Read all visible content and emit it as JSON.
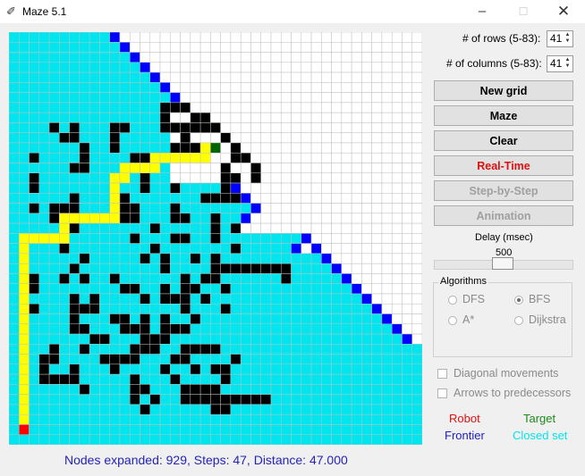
{
  "window": {
    "title": "Maze 5.1",
    "icon": "feather-icon"
  },
  "controls": {
    "rows_label": "# of rows (5-83):",
    "rows_value": "41",
    "cols_label": "# of columns (5-83):",
    "cols_value": "41"
  },
  "buttons": {
    "new_grid": "New grid",
    "maze": "Maze",
    "clear": "Clear",
    "real_time": "Real-Time",
    "step_by_step": "Step-by-Step",
    "animation": "Animation"
  },
  "delay": {
    "label": "Delay (msec)",
    "value": "500"
  },
  "algorithms": {
    "title": "Algorithms",
    "options": [
      "DFS",
      "BFS",
      "A*",
      "Dijkstra"
    ],
    "selected": "BFS"
  },
  "options": {
    "diagonal": "Diagonal movements",
    "arrows": "Arrows to predecessors",
    "diagonal_checked": false,
    "arrows_checked": false
  },
  "legend": {
    "robot": "Robot",
    "target": "Target",
    "frontier": "Frontier",
    "closed": "Closed set",
    "robot_color": "#e01010",
    "target_color": "#1a8a1a",
    "frontier_color": "#2020c0",
    "closed_color": "#00e5ee"
  },
  "status": "Nodes expanded: 929, Steps: 47, Distance: 47.000",
  "grid": {
    "rows": 41,
    "cols": 41,
    "colors": {
      "closed": "#00e5ee",
      "frontier": "#0000ff",
      "wall": "#000000",
      "path": "#ffff00",
      "robot": "#ff0000",
      "target": "#006400",
      "empty": "#ffffff",
      "gridline": "#bfbfbf"
    },
    "robot": [
      39,
      1
    ],
    "target": [
      11,
      20
    ],
    "frontier": [
      [
        0,
        10
      ],
      [
        1,
        11
      ],
      [
        2,
        12
      ],
      [
        3,
        13
      ],
      [
        4,
        14
      ],
      [
        5,
        15
      ],
      [
        6,
        16
      ],
      [
        15,
        22
      ],
      [
        16,
        23
      ],
      [
        17,
        24
      ],
      [
        18,
        23
      ],
      [
        19,
        22
      ],
      [
        20,
        29
      ],
      [
        21,
        28
      ],
      [
        21,
        30
      ],
      [
        22,
        31
      ],
      [
        23,
        32
      ],
      [
        24,
        33
      ],
      [
        25,
        34
      ],
      [
        26,
        35
      ],
      [
        27,
        36
      ],
      [
        28,
        37
      ],
      [
        29,
        38
      ],
      [
        30,
        39
      ]
    ],
    "walls": [
      [
        7,
        15
      ],
      [
        7,
        16
      ],
      [
        7,
        17
      ],
      [
        8,
        15
      ],
      [
        8,
        18
      ],
      [
        8,
        19
      ],
      [
        9,
        4
      ],
      [
        9,
        6
      ],
      [
        9,
        10
      ],
      [
        9,
        11
      ],
      [
        9,
        15
      ],
      [
        9,
        16
      ],
      [
        9,
        17
      ],
      [
        9,
        18
      ],
      [
        9,
        19
      ],
      [
        9,
        20
      ],
      [
        10,
        5
      ],
      [
        10,
        6
      ],
      [
        10,
        10
      ],
      [
        10,
        17
      ],
      [
        10,
        21
      ],
      [
        11,
        7
      ],
      [
        11,
        10
      ],
      [
        11,
        16
      ],
      [
        11,
        17
      ],
      [
        11,
        18
      ],
      [
        11,
        19
      ],
      [
        11,
        22
      ],
      [
        12,
        2
      ],
      [
        12,
        7
      ],
      [
        12,
        12
      ],
      [
        12,
        13
      ],
      [
        12,
        22
      ],
      [
        12,
        23
      ],
      [
        13,
        6
      ],
      [
        13,
        7
      ],
      [
        13,
        21
      ],
      [
        13,
        24
      ],
      [
        14,
        2
      ],
      [
        14,
        13
      ],
      [
        14,
        21
      ],
      [
        14,
        22
      ],
      [
        14,
        24
      ],
      [
        15,
        2
      ],
      [
        15,
        10
      ],
      [
        15,
        13
      ],
      [
        15,
        16
      ],
      [
        15,
        21
      ],
      [
        16,
        6
      ],
      [
        16,
        11
      ],
      [
        16,
        19
      ],
      [
        16,
        20
      ],
      [
        16,
        21
      ],
      [
        16,
        22
      ],
      [
        17,
        2
      ],
      [
        17,
        4
      ],
      [
        17,
        5
      ],
      [
        17,
        6
      ],
      [
        17,
        11
      ],
      [
        17,
        12
      ],
      [
        17,
        16
      ],
      [
        18,
        4
      ],
      [
        18,
        11
      ],
      [
        18,
        12
      ],
      [
        18,
        16
      ],
      [
        18,
        17
      ],
      [
        18,
        20
      ],
      [
        19,
        6
      ],
      [
        19,
        14
      ],
      [
        19,
        20
      ],
      [
        19,
        22
      ],
      [
        20,
        12
      ],
      [
        20,
        16
      ],
      [
        20,
        17
      ],
      [
        20,
        20
      ],
      [
        21,
        5
      ],
      [
        21,
        14
      ],
      [
        21,
        22
      ],
      [
        22,
        7
      ],
      [
        22,
        13
      ],
      [
        22,
        15
      ],
      [
        22,
        18
      ],
      [
        22,
        20
      ],
      [
        23,
        6
      ],
      [
        23,
        15
      ],
      [
        23,
        20
      ],
      [
        23,
        21
      ],
      [
        23,
        22
      ],
      [
        23,
        23
      ],
      [
        23,
        24
      ],
      [
        23,
        25
      ],
      [
        23,
        26
      ],
      [
        23,
        27
      ],
      [
        24,
        2
      ],
      [
        24,
        5
      ],
      [
        24,
        7
      ],
      [
        24,
        10
      ],
      [
        24,
        17
      ],
      [
        24,
        19
      ],
      [
        24,
        20
      ],
      [
        24,
        27
      ],
      [
        25,
        2
      ],
      [
        25,
        11
      ],
      [
        25,
        12
      ],
      [
        25,
        15
      ],
      [
        25,
        17
      ],
      [
        25,
        18
      ],
      [
        25,
        21
      ],
      [
        26,
        6
      ],
      [
        26,
        8
      ],
      [
        26,
        13
      ],
      [
        26,
        15
      ],
      [
        26,
        16
      ],
      [
        26,
        17
      ],
      [
        26,
        19
      ],
      [
        27,
        2
      ],
      [
        27,
        6
      ],
      [
        27,
        7
      ],
      [
        27,
        8
      ],
      [
        27,
        17
      ],
      [
        27,
        21
      ],
      [
        28,
        6
      ],
      [
        28,
        10
      ],
      [
        28,
        11
      ],
      [
        28,
        13
      ],
      [
        28,
        15
      ],
      [
        28,
        18
      ],
      [
        29,
        6
      ],
      [
        29,
        7
      ],
      [
        29,
        11
      ],
      [
        29,
        12
      ],
      [
        29,
        13
      ],
      [
        29,
        15
      ],
      [
        29,
        16
      ],
      [
        29,
        17
      ],
      [
        30,
        8
      ],
      [
        30,
        9
      ],
      [
        30,
        13
      ],
      [
        30,
        14
      ],
      [
        30,
        15
      ],
      [
        31,
        4
      ],
      [
        31,
        7
      ],
      [
        31,
        12
      ],
      [
        31,
        13
      ],
      [
        31,
        14
      ],
      [
        31,
        17
      ],
      [
        31,
        18
      ],
      [
        31,
        19
      ],
      [
        31,
        20
      ],
      [
        32,
        3
      ],
      [
        32,
        4
      ],
      [
        32,
        9
      ],
      [
        32,
        10
      ],
      [
        32,
        11
      ],
      [
        32,
        12
      ],
      [
        32,
        16
      ],
      [
        32,
        17
      ],
      [
        32,
        22
      ],
      [
        33,
        3
      ],
      [
        33,
        6
      ],
      [
        33,
        10
      ],
      [
        33,
        15
      ],
      [
        33,
        18
      ],
      [
        33,
        20
      ],
      [
        33,
        21
      ],
      [
        34,
        3
      ],
      [
        34,
        4
      ],
      [
        34,
        5
      ],
      [
        34,
        6
      ],
      [
        34,
        12
      ],
      [
        34,
        16
      ],
      [
        34,
        21
      ],
      [
        35,
        7
      ],
      [
        35,
        12
      ],
      [
        35,
        13
      ],
      [
        35,
        17
      ],
      [
        35,
        18
      ],
      [
        35,
        19
      ],
      [
        35,
        20
      ],
      [
        36,
        12
      ],
      [
        36,
        14
      ],
      [
        36,
        17
      ],
      [
        36,
        18
      ],
      [
        36,
        19
      ],
      [
        36,
        20
      ],
      [
        36,
        21
      ],
      [
        36,
        22
      ],
      [
        36,
        23
      ],
      [
        36,
        24
      ],
      [
        36,
        25
      ],
      [
        37,
        13
      ],
      [
        37,
        20
      ],
      [
        37,
        21
      ]
    ],
    "path": [
      [
        11,
        19
      ],
      [
        11,
        20
      ],
      [
        12,
        14
      ],
      [
        12,
        15
      ],
      [
        12,
        16
      ],
      [
        12,
        17
      ],
      [
        12,
        18
      ],
      [
        12,
        19
      ],
      [
        13,
        11
      ],
      [
        13,
        12
      ],
      [
        13,
        13
      ],
      [
        13,
        14
      ],
      [
        14,
        10
      ],
      [
        14,
        11
      ],
      [
        15,
        10
      ],
      [
        16,
        10
      ],
      [
        17,
        10
      ],
      [
        18,
        5
      ],
      [
        18,
        6
      ],
      [
        18,
        7
      ],
      [
        18,
        8
      ],
      [
        18,
        9
      ],
      [
        18,
        10
      ],
      [
        19,
        5
      ],
      [
        20,
        1
      ],
      [
        20,
        2
      ],
      [
        20,
        3
      ],
      [
        20,
        4
      ],
      [
        20,
        5
      ],
      [
        21,
        1
      ],
      [
        22,
        1
      ],
      [
        23,
        1
      ],
      [
        24,
        1
      ],
      [
        25,
        1
      ],
      [
        26,
        1
      ],
      [
        27,
        1
      ],
      [
        28,
        1
      ],
      [
        29,
        1
      ],
      [
        30,
        1
      ],
      [
        31,
        1
      ],
      [
        32,
        1
      ],
      [
        33,
        1
      ],
      [
        34,
        1
      ],
      [
        35,
        1
      ],
      [
        36,
        1
      ],
      [
        37,
        1
      ],
      [
        38,
        1
      ]
    ]
  }
}
